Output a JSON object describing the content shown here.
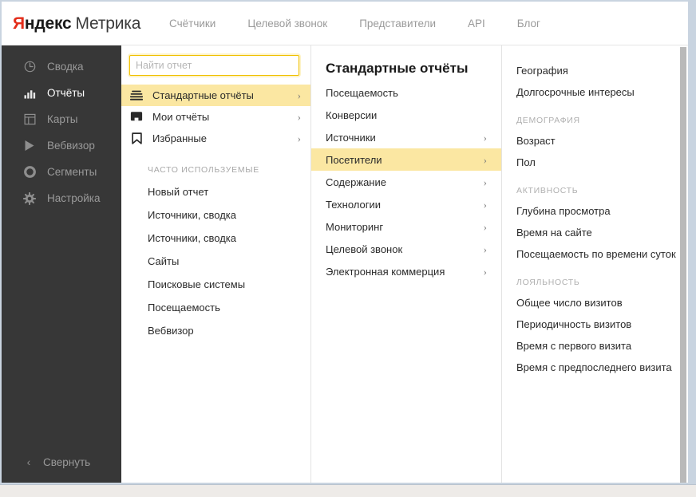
{
  "header": {
    "logo_ya": "Я",
    "logo_ndeks": "ндекс",
    "logo_metrika": "Метрика",
    "nav": [
      {
        "label": "Счётчики"
      },
      {
        "label": "Целевой звонок"
      },
      {
        "label": "Представители"
      },
      {
        "label": "API"
      },
      {
        "label": "Блог"
      }
    ]
  },
  "sidebar": {
    "items": [
      {
        "label": "Сводка",
        "icon": "gauge-icon",
        "active": false
      },
      {
        "label": "Отчёты",
        "icon": "bar-chart-icon",
        "active": true
      },
      {
        "label": "Карты",
        "icon": "layout-icon",
        "active": false
      },
      {
        "label": "Вебвизор",
        "icon": "play-icon",
        "active": false
      },
      {
        "label": "Сегменты",
        "icon": "donut-icon",
        "active": false
      },
      {
        "label": "Настройка",
        "icon": "gear-icon",
        "active": false
      }
    ],
    "collapse": {
      "label": "Свернуть",
      "icon": "chevron-left-icon",
      "glyph": "‹"
    }
  },
  "reports_panel": {
    "search": {
      "placeholder": "Найти отчет",
      "value": ""
    },
    "menu": [
      {
        "label": "Стандартные отчёты",
        "icon": "stacked-lines-icon",
        "selected": true,
        "arrow": "›"
      },
      {
        "label": "Мои отчёты",
        "icon": "monitor-icon",
        "selected": false,
        "arrow": "›"
      },
      {
        "label": "Избранные",
        "icon": "bookmark-icon",
        "selected": false,
        "arrow": "›"
      }
    ],
    "frequent_heading": "ЧАСТО ИСПОЛЬЗУЕМЫЕ",
    "frequent": [
      {
        "label": "Новый отчет"
      },
      {
        "label": "Источники, сводка"
      },
      {
        "label": "Источники, сводка"
      },
      {
        "label": "Сайты"
      },
      {
        "label": "Поисковые системы"
      },
      {
        "label": "Посещаемость"
      },
      {
        "label": "Вебвизор"
      }
    ]
  },
  "standard_reports": {
    "title": "Стандартные отчёты",
    "items": [
      {
        "label": "Посещаемость",
        "arrow": "",
        "selected": false
      },
      {
        "label": "Конверсии",
        "arrow": "",
        "selected": false
      },
      {
        "label": "Источники",
        "arrow": "›",
        "selected": false
      },
      {
        "label": "Посетители",
        "arrow": "›",
        "selected": true
      },
      {
        "label": "Содержание",
        "arrow": "›",
        "selected": false
      },
      {
        "label": "Технологии",
        "arrow": "›",
        "selected": false
      },
      {
        "label": "Мониторинг",
        "arrow": "›",
        "selected": false
      },
      {
        "label": "Целевой звонок",
        "arrow": "›",
        "selected": false
      },
      {
        "label": "Электронная коммерция",
        "arrow": "›",
        "selected": false
      }
    ]
  },
  "visitors_submenu": {
    "top_items": [
      {
        "label": "География"
      },
      {
        "label": "Долгосрочные интересы"
      }
    ],
    "groups": [
      {
        "heading": "ДЕМОГРАФИЯ",
        "items": [
          {
            "label": "Возраст"
          },
          {
            "label": "Пол"
          }
        ]
      },
      {
        "heading": "АКТИВНОСТЬ",
        "items": [
          {
            "label": "Глубина просмотра"
          },
          {
            "label": "Время на сайте"
          },
          {
            "label": "Посещаемость по времени суток"
          }
        ]
      },
      {
        "heading": "ЛОЯЛЬНОСТЬ",
        "items": [
          {
            "label": "Общее число визитов"
          },
          {
            "label": "Периодичность визитов"
          },
          {
            "label": "Время с первого визита"
          },
          {
            "label": "Время с предпоследнего визита"
          }
        ]
      }
    ]
  },
  "colors": {
    "brand_red": "#e32d1a",
    "highlight_yellow": "#fbe7a2",
    "sidebar_dark": "#373737",
    "focus_border": "#f0c000"
  }
}
